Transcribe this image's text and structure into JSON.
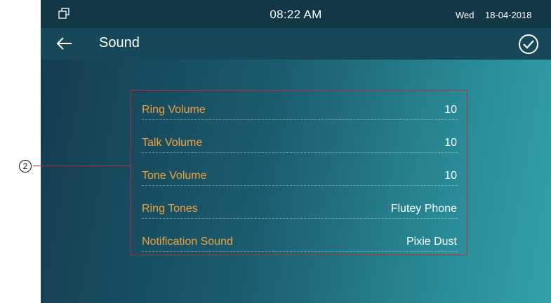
{
  "status_bar": {
    "icon": "recent-apps-icon",
    "time": "08:22 AM",
    "day": "Wed",
    "date": "18-04-2018"
  },
  "title_bar": {
    "back_icon": "back-arrow-icon",
    "title": "Sound",
    "confirm_icon": "check-circle-icon"
  },
  "callout": {
    "number": "②",
    "color": "#b3303d"
  },
  "settings": [
    {
      "label": "Ring Volume",
      "value": "10"
    },
    {
      "label": "Talk Volume",
      "value": "10"
    },
    {
      "label": "Tone Volume",
      "value": "10"
    },
    {
      "label": "Ring Tones",
      "value": "Flutey Phone"
    },
    {
      "label": "Notification Sound",
      "value": "Pixie Dust"
    }
  ],
  "colors": {
    "label": "#f0a23a",
    "value": "#ffffff",
    "status_bar_bg": "#143746",
    "title_bar_bg": "#16485a"
  }
}
